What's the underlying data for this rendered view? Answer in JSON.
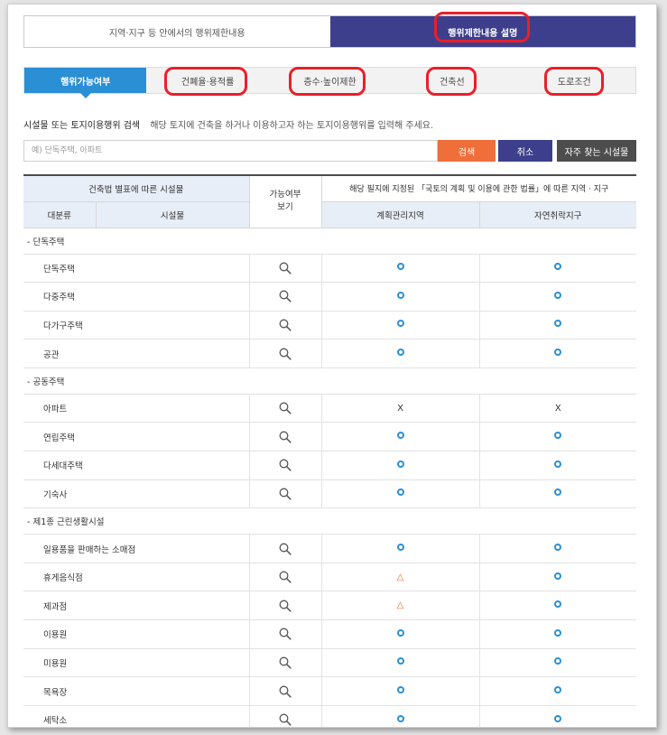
{
  "top_tabs": [
    {
      "label": "지역·지구 등 안에서의 행위제한내용",
      "active": false
    },
    {
      "label": "행위제한내용 설명",
      "active": true
    }
  ],
  "sub_tabs": [
    {
      "label": "행위가능여부",
      "active": true
    },
    {
      "label": "건폐율·용적률",
      "active": false
    },
    {
      "label": "층수·높이제한",
      "active": false
    },
    {
      "label": "건축선",
      "active": false
    },
    {
      "label": "도로조건",
      "active": false
    }
  ],
  "search": {
    "title": "시설물 또는 토지이용행위 검색",
    "description": "해당 토지에 건축을 하거나 이용하고자 하는 토지이용행위를 입력해 주세요.",
    "placeholder": "예) 단독주택, 아파트",
    "value": "",
    "search_label": "검색",
    "cancel_label": "취소",
    "frequent_label": "자주 찾는 시설물"
  },
  "table": {
    "header_building": "건축법 별표에 따른 시설물",
    "header_possible": "가능여부\n보기",
    "header_law": "해당 필지에 지정된 「국토의 계획 및 이용에 관한 법률」에 따른 지역 · 지구",
    "header_category": "대분류",
    "header_facility": "시설물",
    "zone1": "계획관리지역",
    "zone2": "자연취락지구",
    "rows": [
      {
        "type": "category",
        "label": "- 단독주택"
      },
      {
        "type": "item",
        "name": "단독주택",
        "z1": "o",
        "z2": "o"
      },
      {
        "type": "item",
        "name": "다중주택",
        "z1": "o",
        "z2": "o"
      },
      {
        "type": "item",
        "name": "다가구주택",
        "z1": "o",
        "z2": "o"
      },
      {
        "type": "item",
        "name": "공관",
        "z1": "o",
        "z2": "o"
      },
      {
        "type": "category",
        "label": "- 공동주택"
      },
      {
        "type": "item",
        "name": "아파트",
        "z1": "x",
        "z2": "x"
      },
      {
        "type": "item",
        "name": "연립주택",
        "z1": "o",
        "z2": "o"
      },
      {
        "type": "item",
        "name": "다세대주택",
        "z1": "o",
        "z2": "o"
      },
      {
        "type": "item",
        "name": "기숙사",
        "z1": "o",
        "z2": "o"
      },
      {
        "type": "category",
        "label": "- 제1종 근린생활시설"
      },
      {
        "type": "item",
        "name": "일용품을 판매하는 소매점",
        "z1": "o",
        "z2": "o"
      },
      {
        "type": "item",
        "name": "휴게음식점",
        "z1": "t",
        "z2": "o"
      },
      {
        "type": "item",
        "name": "제과점",
        "z1": "t",
        "z2": "o"
      },
      {
        "type": "item",
        "name": "이용원",
        "z1": "o",
        "z2": "o"
      },
      {
        "type": "item",
        "name": "미용원",
        "z1": "o",
        "z2": "o"
      },
      {
        "type": "item",
        "name": "목욕장",
        "z1": "o",
        "z2": "o"
      },
      {
        "type": "item",
        "name": "세탁소",
        "z1": "o",
        "z2": "o"
      }
    ]
  },
  "marks": {
    "x": "X",
    "t": "△"
  },
  "colors": {
    "accent_blue": "#2b8fd6",
    "navy": "#3d3f8c",
    "search_orange": "#f06e3a",
    "highlight_red": "#e8202a"
  }
}
